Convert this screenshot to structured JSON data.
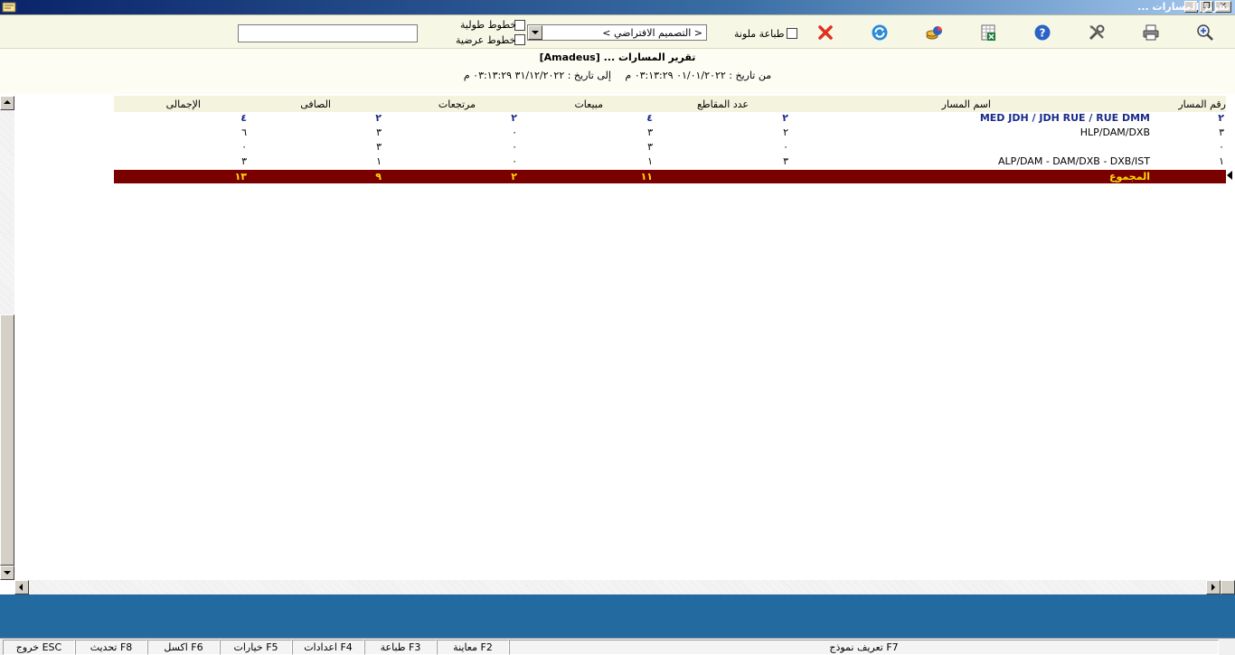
{
  "window": {
    "title": "تقرير المسارات ..."
  },
  "toolbar": {
    "colored_print_label": "طباعة ملونة",
    "vertical_lines_label": "خطوط طولية",
    "horizontal_lines_label": "خطوط عرضية",
    "design_select_value": "< التصميم الافتراضي >",
    "search_value": "",
    "icons": [
      "zoom-icon",
      "print-icon",
      "tools-icon",
      "help-icon",
      "excel-icon",
      "chart-icon",
      "refresh-icon",
      "close-icon"
    ]
  },
  "report": {
    "title": "تقرير المسارات ... [Amadeus]",
    "from_date": "من تاريخ : ٠١/٠١/٢٠٢٢ ٠٣:١٣:٢٩ م",
    "to_date": "إلى تاريخ : ٣١/١٢/٢٠٢٢ ٠٣:١٣:٢٩ م"
  },
  "table": {
    "headers": {
      "route_no": "رقم المسار",
      "route_name": "اسم المسار",
      "segments": "عدد المقاطع",
      "sales": "مبيعات",
      "refunds": "مرتجعات",
      "net": "الصافى",
      "total": "الإجمالى"
    },
    "rows": [
      {
        "route_no": "٢",
        "route_name": "MED JDH / JDH RUE / RUE DMM",
        "segments": "٢",
        "sales": "٤",
        "refunds": "٢",
        "net": "٢",
        "total": "٤"
      },
      {
        "route_no": "٣",
        "route_name": "HLP/DAM/DXB",
        "segments": "٢",
        "sales": "٣",
        "refunds": "٠",
        "net": "٣",
        "total": "٦"
      },
      {
        "route_no": "٠",
        "route_name": "",
        "segments": "٠",
        "sales": "٣",
        "refunds": "٠",
        "net": "٣",
        "total": "٠"
      },
      {
        "route_no": "١",
        "route_name": "ALP/DAM - DAM/DXB - DXB/IST",
        "segments": "٣",
        "sales": "١",
        "refunds": "٠",
        "net": "١",
        "total": "٣"
      }
    ],
    "total_row": {
      "label": "المجموع",
      "sales": "١١",
      "refunds": "٢",
      "net": "٩",
      "total": "١٣"
    }
  },
  "statusbar": {
    "items": [
      "F7 تعريف نموذج",
      "F2 معاينة",
      "F3 طباعة",
      "F4 اعدادات",
      "F5 خيارات",
      "F6 اكسل",
      "F8 تحديث",
      "ESC خروج"
    ]
  },
  "colors": {
    "title_bar_start": "#0a246a",
    "toolbar_bg": "#f6f7e4",
    "total_row_bg": "#7a0000",
    "total_row_text": "#ffdd00",
    "bold_row_text": "#1a2a8a",
    "blue_band": "#236aa0"
  }
}
